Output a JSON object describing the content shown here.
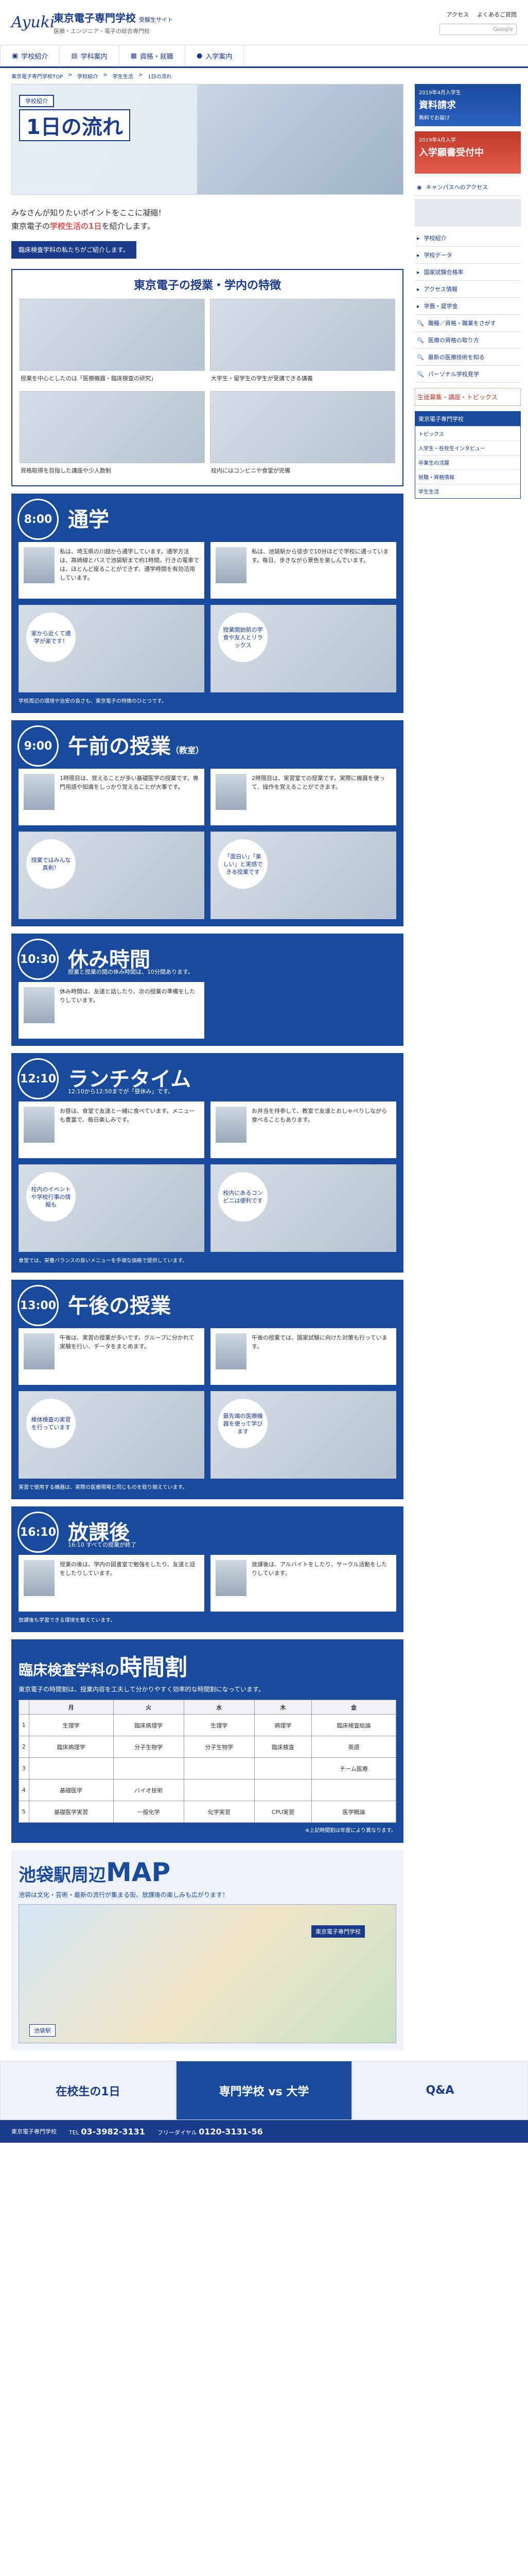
{
  "header": {
    "logo": "Ayuki",
    "school": "東京電子専門学校",
    "site": "受験生サイト",
    "sub": "医療・エンジニア・電子の総合専門校",
    "links": [
      "アクセス",
      "よくあるご質問"
    ],
    "search_placeholder": "Google"
  },
  "nav": [
    "学校紹介",
    "学科案内",
    "資格・就職",
    "入学案内"
  ],
  "breadcrumb": [
    "東京電子専門学校TOP",
    "学校紹介",
    "学生生活",
    "1日の流れ"
  ],
  "hero": {
    "tag": "学校紹介",
    "title": "1日の流れ"
  },
  "lead": {
    "line1": "みなさんが知りたいポイントをここに凝縮！",
    "line2_a": "東京電子の",
    "line2_b": "学校生活の1日",
    "line2_c": "を紹介します。",
    "bar": "臨床検査学科の私たちがご紹介します。"
  },
  "features": {
    "title": "東京電子の授業・学内の特徴",
    "items": [
      "授業を中心としたのは「医療機器・臨床検査の研究」",
      "大学生・留学生の学生が受講できる講義",
      "資格取得を目指した講座や少人数制",
      "校内にはコンビニや食堂が完備"
    ]
  },
  "sections": [
    {
      "time": "8:00",
      "title": "通学",
      "sub": "",
      "cards": [
        "私は、埼玉県の川越から通学しています。通学方法は、高崎線とバスで池袋駅まで約1時間。行きの電車では、ほとんど座ることができず、通学時間を有効活用しています。",
        "私は、池袋駅から徒歩で10分ほどで学校に通っています。毎日、歩きながら景色を楽しんでいます。"
      ],
      "bubbles": [
        "家から近くて通学が楽です！",
        "授業開始前の学食や友人とリラックス"
      ],
      "note": "学校周辺の環境や治安の良さも、東京電子の特徴のひとつです。"
    },
    {
      "time": "9:00",
      "title": "午前の授業",
      "title_small": "（教室）",
      "sub": "",
      "cards": [
        "1時限目は、覚えることが多い基礎医学の授業です。専門用語や知識をしっかり覚えることが大事です。",
        "2時限目は、実習室での授業です。実際に機器を使って、操作を覚えることができます。"
      ],
      "bubbles": [
        "授業ではみんな真剣！",
        "「面白い」「楽しい」と実感できる授業です"
      ],
      "note": ""
    },
    {
      "time": "10:30",
      "title": "休み時間",
      "sub": "授業と授業の間の休み時間は、10分間あります。",
      "cards": [
        "休み時間は、友達と話したり、次の授業の準備をしたりしています。"
      ],
      "bubbles": [],
      "note": ""
    },
    {
      "time": "12:10",
      "title": "ランチタイム",
      "sub": "12:10から12:50までが「昼休み」です。",
      "cards": [
        "お昼は、食堂で友達と一緒に食べています。メニューも豊富で、毎日楽しみです。",
        "お弁当を持参して、教室で友達とおしゃべりしながら食べることもあります。"
      ],
      "bubbles": [
        "校内のイベントや学校行事の情報も",
        "校内にあるコンビニは便利です"
      ],
      "note": "食堂では、栄養バランスの良いメニューを手頃な価格で提供しています。"
    },
    {
      "time": "13:00",
      "title": "午後の授業",
      "sub": "",
      "cards": [
        "午後は、実習の授業が多いです。グループに分かれて実験を行い、データをまとめます。",
        "午後の授業では、国家試験に向けた対策も行っています。"
      ],
      "bubbles": [
        "検体検査の実習を行っています",
        "最先端の医療機器を使って学びます"
      ],
      "note": "実習で使用する機器は、実際の医療現場と同じものを取り揃えています。"
    },
    {
      "time": "16:10",
      "title": "放課後",
      "sub": "16:10 すべての授業が終了",
      "cards": [
        "授業の後は、学内の図書室で勉強をしたり、友達と話をしたりしています。",
        "放課後は、アルバイトをしたり、サークル活動をしたりしています。"
      ],
      "bubbles": [],
      "note": "放課後も学習できる環境を整えています。"
    }
  ],
  "timetable": {
    "title_a": "臨床検査学科の",
    "title_b": "時間割",
    "lead": "東京電子の時間割は、授業内容を工夫して分かりやすく効率的な時間割になっています。",
    "headers": [
      "",
      "月",
      "火",
      "水",
      "木",
      "金"
    ],
    "rows": [
      [
        "1",
        "生理学",
        "臨床病理学",
        "生理学",
        "病理学",
        "臨床検査総論"
      ],
      [
        "2",
        "臨床病理学",
        "分子生物学",
        "分子生物学",
        "臨床検査",
        "英語"
      ],
      [
        "3",
        "",
        "",
        "",
        "",
        "チーム医療"
      ],
      [
        "4",
        "基礎医学",
        "バイオ技術",
        "",
        "",
        ""
      ],
      [
        "5",
        "基礎医学実習",
        "一般化学",
        "化学実習",
        "CPU実習",
        "医学概論"
      ]
    ],
    "note": "※上記時間割は年度により異なります。"
  },
  "map": {
    "title_a": "池袋駅周辺",
    "title_b": "MAP",
    "lead": "池袋は文化・芸術・最新の流行が集まる街。放課後の楽しみも広がります！",
    "school_pin": "東京電子専門学校",
    "station": "池袋駅"
  },
  "side": {
    "banner1_small": "2019年4月入学生",
    "banner1_big": "資料請求",
    "banner1_note": "無料でお届け",
    "banner2_small": "2019年4月入学",
    "banner2_big": "入学願書受付中",
    "campus_access": "キャンパスへのアクセス",
    "menu": [
      "学校紹介",
      "学校データ",
      "国家試験合格率",
      "アクセス情報",
      "学費・奨学金"
    ],
    "items": [
      "職種／資格・職業をさがす",
      "医療の資格の取り方",
      "最新の医療技術を知る",
      "パーソナル学校見学"
    ],
    "highlight": "生徒募集・講座・トピックス",
    "box_title": "東京電子専門学校",
    "box_items": [
      "トピックス",
      "入学生・在校生インタビュー",
      "卒業生の活躍",
      "就職・資格情報",
      "学生生活"
    ]
  },
  "footer_banners": [
    "在校生の1日",
    "専門学校 vs 大学",
    "Q&A"
  ],
  "footer": {
    "school": "東京電子専門学校",
    "tel_label": "TEL",
    "tel": "03-3982-3131",
    "free_label": "フリーダイヤル",
    "free": "0120-3131-56"
  }
}
